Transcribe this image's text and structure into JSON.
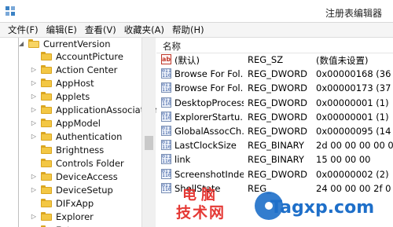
{
  "window": {
    "title": "注册表编辑器"
  },
  "menu": [
    {
      "label": "文件(F)"
    },
    {
      "label": "编辑(E)"
    },
    {
      "label": "查看(V)"
    },
    {
      "label": "收藏夹(A)"
    },
    {
      "label": "帮助(H)"
    }
  ],
  "tree": {
    "parent": {
      "label": "CurrentVersion"
    },
    "children": [
      {
        "label": "AccountPicture",
        "expander": ""
      },
      {
        "label": "Action Center",
        "expander": "▷"
      },
      {
        "label": "AppHost",
        "expander": "▷"
      },
      {
        "label": "Applets",
        "expander": "▷"
      },
      {
        "label": "ApplicationAssociation",
        "expander": "▷"
      },
      {
        "label": "AppModel",
        "expander": "▷"
      },
      {
        "label": "Authentication",
        "expander": "▷"
      },
      {
        "label": "Brightness",
        "expander": ""
      },
      {
        "label": "Controls Folder",
        "expander": ""
      },
      {
        "label": "DeviceAccess",
        "expander": "▷"
      },
      {
        "label": "DeviceSetup",
        "expander": "▷"
      },
      {
        "label": "DIFxApp",
        "expander": ""
      },
      {
        "label": "Explorer",
        "expander": "▷"
      },
      {
        "label": "Ext",
        "expander": "▷"
      }
    ]
  },
  "list": {
    "column_name": "名称",
    "rows": [
      {
        "icon": "string-value-icon",
        "name": "(默认)",
        "type": "REG_SZ",
        "data": "(数值未设置)"
      },
      {
        "icon": "binary-value-icon",
        "name": "Browse For Fol...",
        "type": "REG_DWORD",
        "data": "0x00000168 (36"
      },
      {
        "icon": "binary-value-icon",
        "name": "Browse For Fol...",
        "type": "REG_DWORD",
        "data": "0x00000173 (37"
      },
      {
        "icon": "binary-value-icon",
        "name": "DesktopProcess",
        "type": "REG_DWORD",
        "data": "0x00000001 (1)"
      },
      {
        "icon": "binary-value-icon",
        "name": "ExplorerStartu...",
        "type": "REG_DWORD",
        "data": "0x00000001 (1)"
      },
      {
        "icon": "binary-value-icon",
        "name": "GlobalAssocCh...",
        "type": "REG_DWORD",
        "data": "0x00000095 (14"
      },
      {
        "icon": "binary-value-icon",
        "name": "LastClockSize",
        "type": "REG_BINARY",
        "data": "2d 00 00 00 00 0"
      },
      {
        "icon": "binary-value-icon",
        "name": "link",
        "type": "REG_BINARY",
        "data": "15 00 00 00"
      },
      {
        "icon": "binary-value-icon",
        "name": "ScreenshotIndex",
        "type": "REG_DWORD",
        "data": "0x00000002 (2)"
      },
      {
        "icon": "binary-value-icon",
        "name": "ShellState",
        "type": "REG_",
        "data": "24 00 00 00 2f 0"
      }
    ]
  },
  "watermark": {
    "line1": "电脑",
    "line2": "技术网",
    "site": "Tagxp.com"
  }
}
